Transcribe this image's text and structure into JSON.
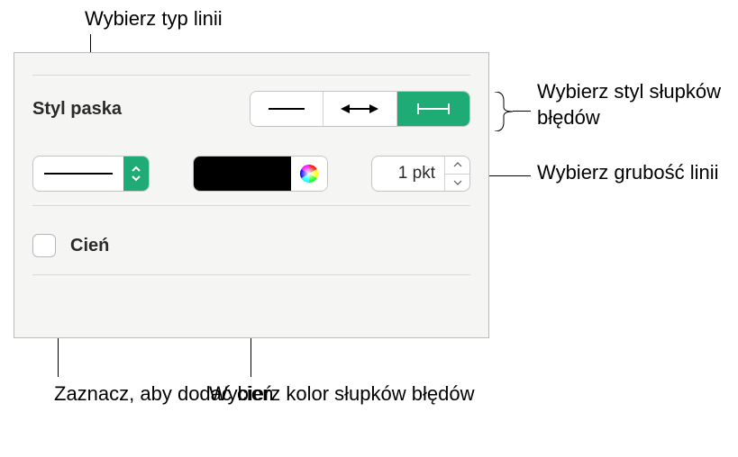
{
  "callouts": {
    "line_type": "Wybierz typ linii",
    "error_bar_style": "Wybierz styl słupków błędów",
    "thickness": "Wybierz grubość linii",
    "color": "Wybierz kolor słupków błędów",
    "shadow": "Zaznacz, aby dodać cień"
  },
  "panel": {
    "section_label": "Styl paska",
    "thickness_value": "1 pkt",
    "shadow_label": "Cień",
    "color_swatch": "#000000"
  }
}
